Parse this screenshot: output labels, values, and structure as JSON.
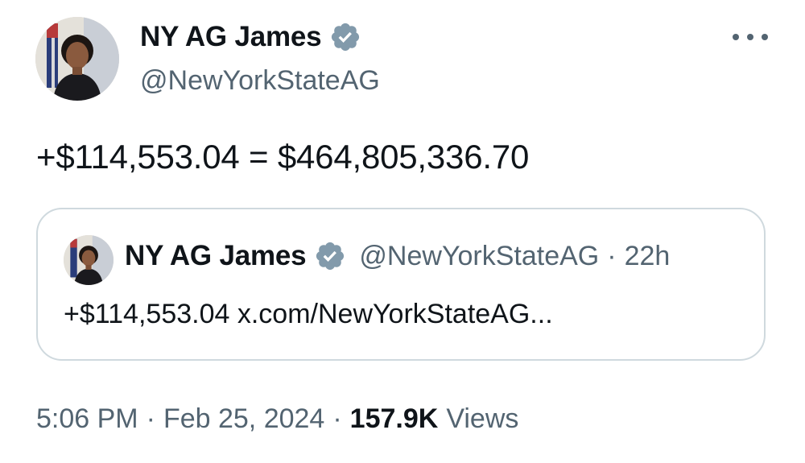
{
  "author": {
    "display_name": "NY AG James",
    "handle": "@NewYorkStateAG",
    "verified_icon": "verified-badge-icon",
    "avatar_icon": "avatar"
  },
  "tweet": {
    "text": "+$114,553.04 = $464,805,336.70"
  },
  "quoted_tweet": {
    "display_name": "NY AG James",
    "handle": "@NewYorkStateAG",
    "separator": "·",
    "time": "22h",
    "text": "+$114,553.04 x.com/NewYorkStateAG..."
  },
  "meta": {
    "time": "5:06 PM",
    "separator": "·",
    "date": "Feb 25, 2024",
    "views_count": "157.9K",
    "views_label": "Views"
  },
  "colors": {
    "text_primary": "#0f1419",
    "text_secondary": "#536471",
    "verified": "#829aab",
    "border": "#cfd9de"
  }
}
